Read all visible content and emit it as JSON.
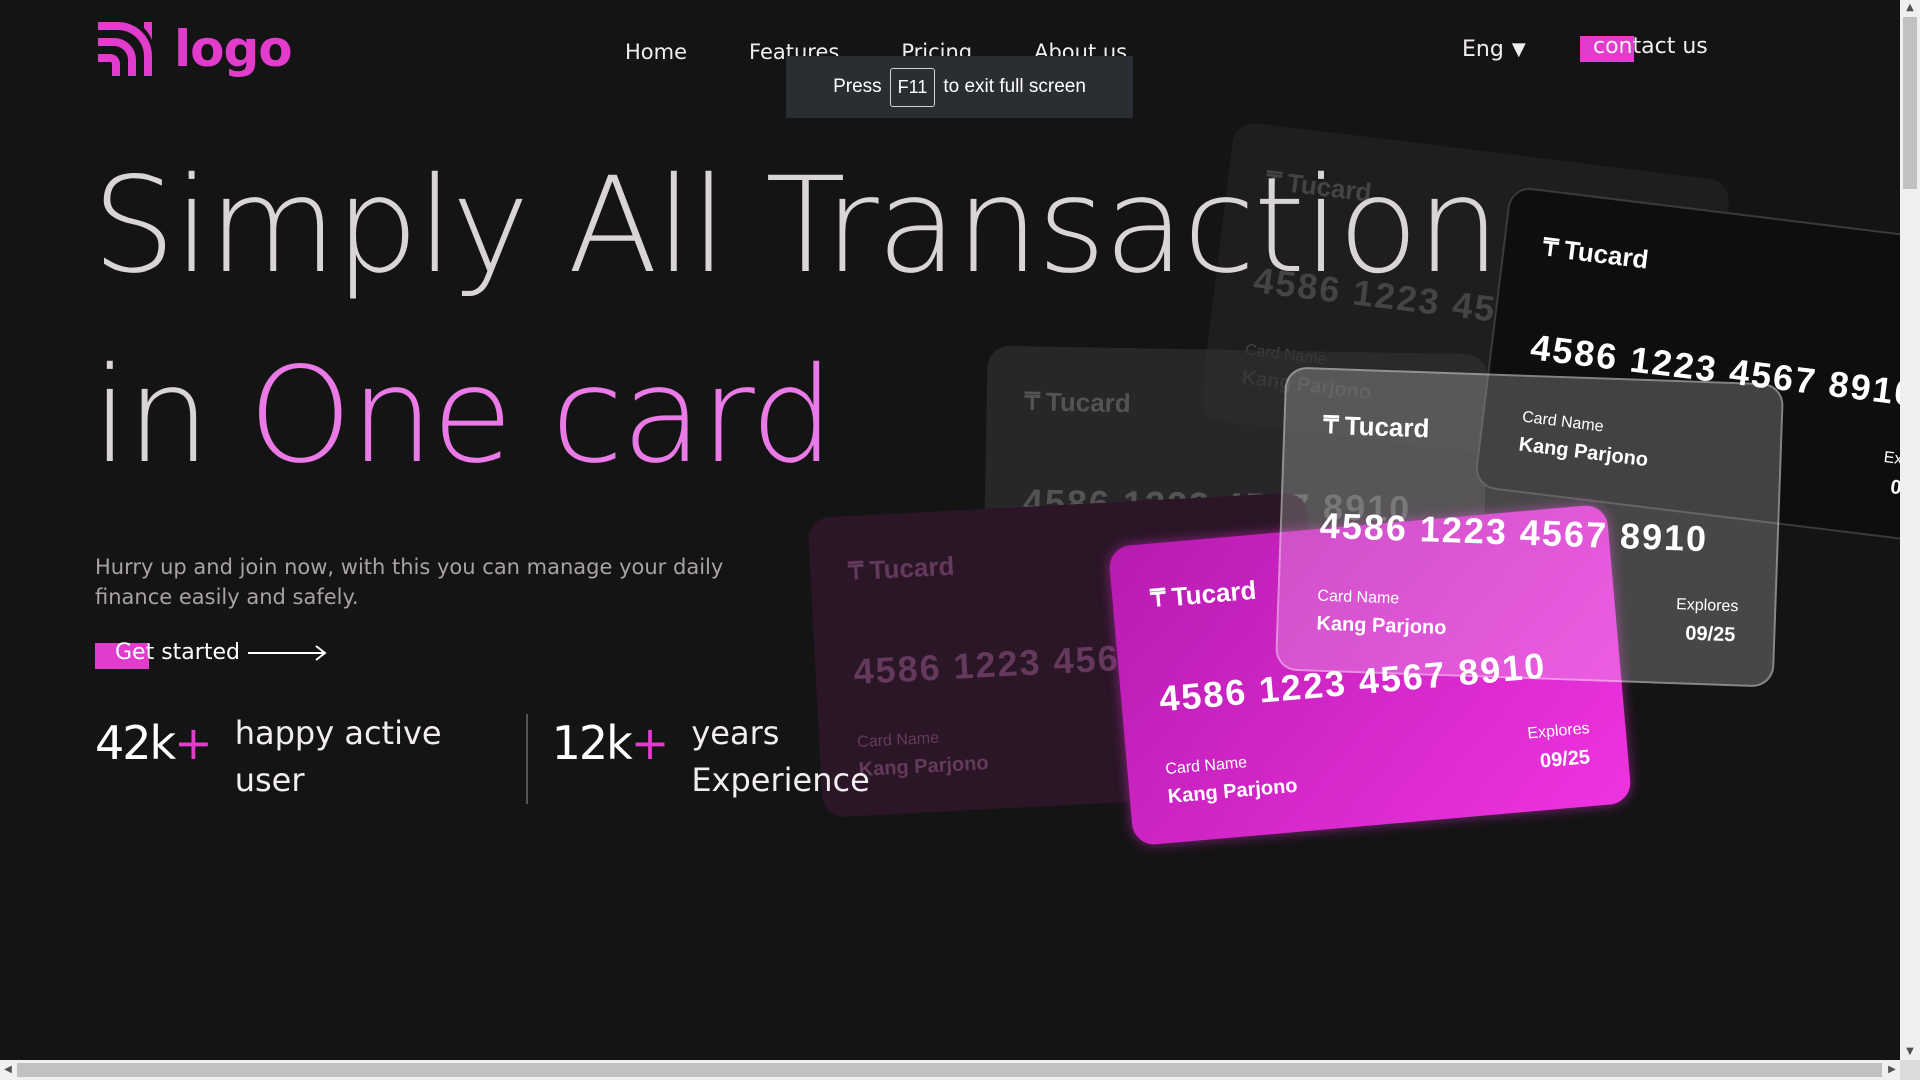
{
  "header": {
    "logo_text": "logo",
    "nav": [
      "Home",
      "Features",
      "Pricing",
      "About us"
    ],
    "language": "Eng",
    "language_caret": "▼",
    "contact_label": "contact us"
  },
  "fullscreen_toast": {
    "prefix": "Press",
    "key": "F11",
    "suffix": "to exit full screen"
  },
  "hero": {
    "line1": "Simply All Transaction",
    "line2_plain": "in",
    "line2_accent": "One card",
    "subtitle": "Hurry up and join now, with this you can manage your daily finance easily and safely.",
    "cta_label": "Get started"
  },
  "stats": [
    {
      "number": "42k",
      "plus": "+",
      "label_line1": "happy active",
      "label_line2": "user"
    },
    {
      "number": "12k",
      "plus": "+",
      "label_line1": "years",
      "label_line2": "Experience"
    }
  ],
  "cards": {
    "brand": "Tucard",
    "number": "4586 1223 4567 8910",
    "name_label": "Card Name",
    "name": "Kang Parjono",
    "expiry_label": "Explores",
    "expiry": "09/25"
  },
  "colors": {
    "accent": "#e23ccd",
    "accent_text": "#e97ae6",
    "background": "#151415"
  }
}
